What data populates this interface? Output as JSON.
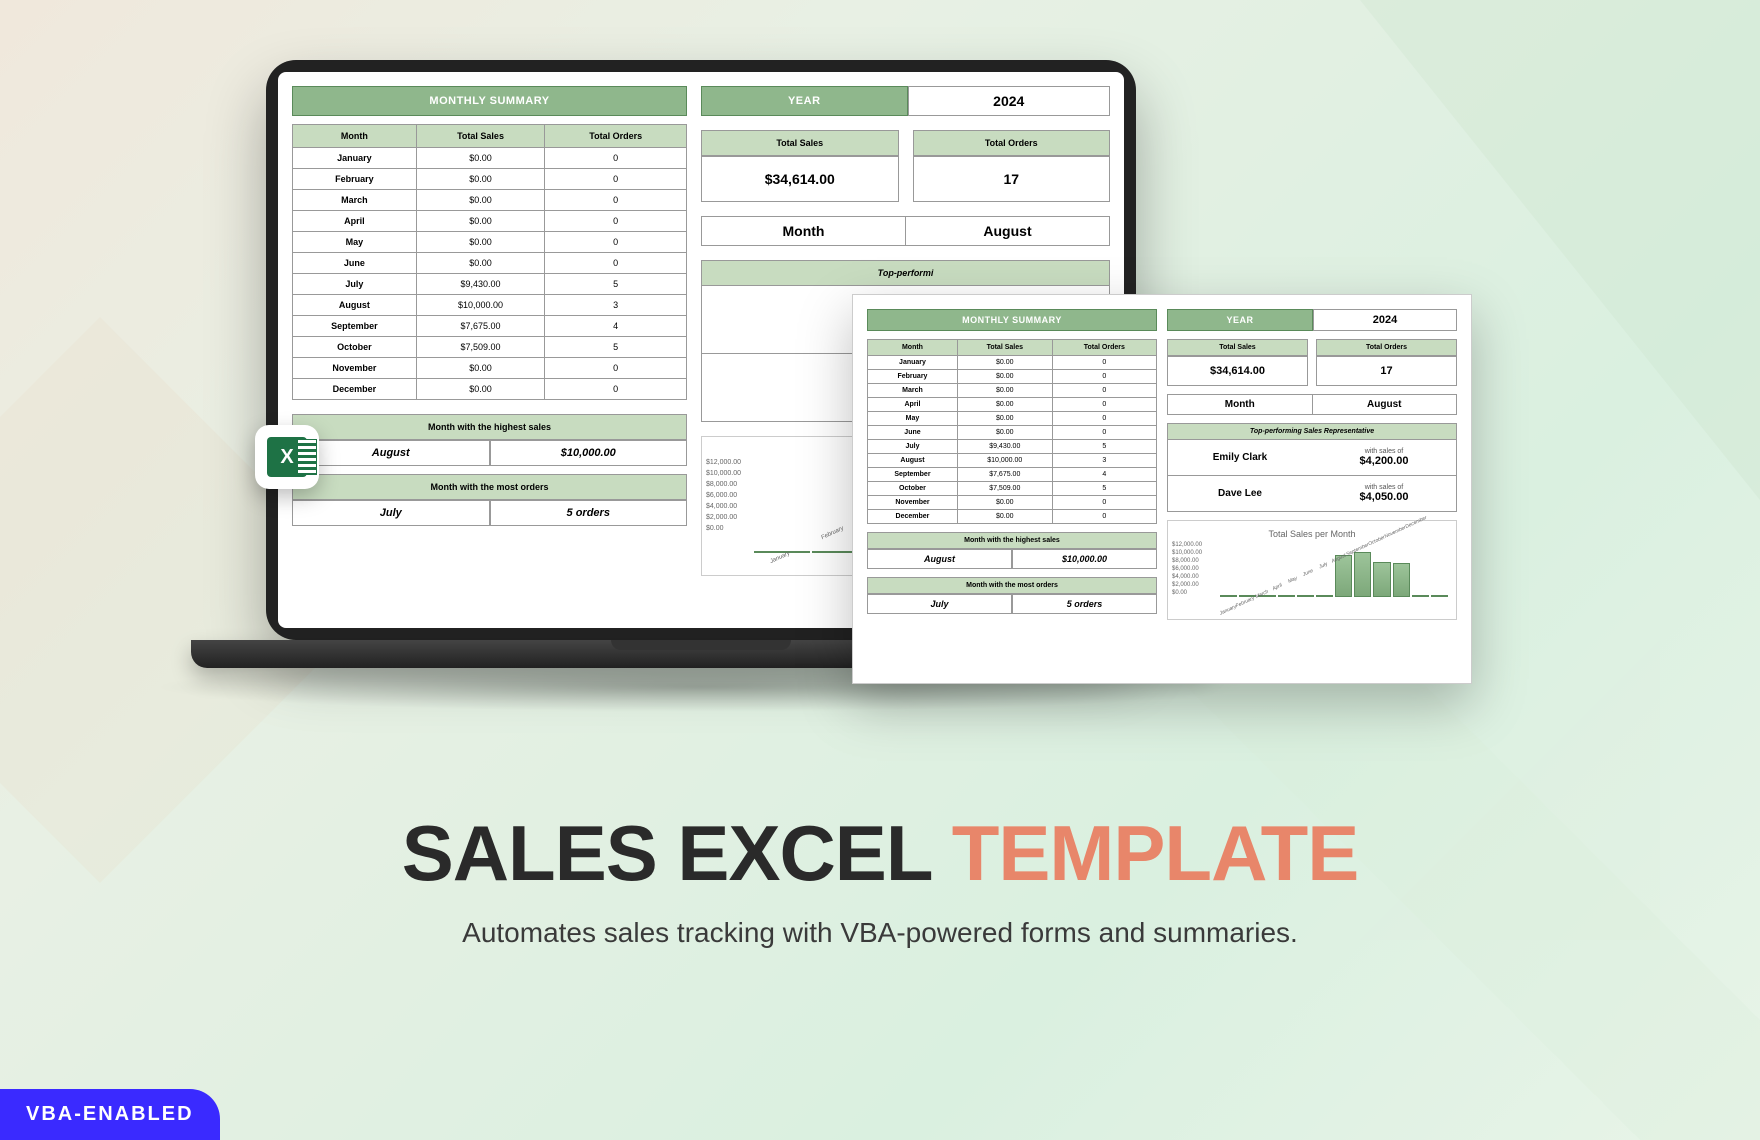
{
  "title": {
    "text1": "SALES EXCEL ",
    "text2": "TEMPLATE"
  },
  "subtitle": "Automates sales tracking with VBA-powered forms and summaries.",
  "badge": "VBA-ENABLED",
  "excel_icon_letter": "X",
  "summary": {
    "header": "MONTHLY SUMMARY",
    "cols": [
      "Month",
      "Total Sales",
      "Total Orders"
    ],
    "rows": [
      {
        "m": "January",
        "s": "$0.00",
        "o": "0"
      },
      {
        "m": "February",
        "s": "$0.00",
        "o": "0"
      },
      {
        "m": "March",
        "s": "$0.00",
        "o": "0"
      },
      {
        "m": "April",
        "s": "$0.00",
        "o": "0"
      },
      {
        "m": "May",
        "s": "$0.00",
        "o": "0"
      },
      {
        "m": "June",
        "s": "$0.00",
        "o": "0"
      },
      {
        "m": "July",
        "s": "$9,430.00",
        "o": "5"
      },
      {
        "m": "August",
        "s": "$10,000.00",
        "o": "3"
      },
      {
        "m": "September",
        "s": "$7,675.00",
        "o": "4"
      },
      {
        "m": "October",
        "s": "$7,509.00",
        "o": "5"
      },
      {
        "m": "November",
        "s": "$0.00",
        "o": "0"
      },
      {
        "m": "December",
        "s": "$0.00",
        "o": "0"
      }
    ]
  },
  "year": {
    "label": "YEAR",
    "value": "2024"
  },
  "totals": {
    "sales_label": "Total Sales",
    "sales_value": "$34,614.00",
    "orders_label": "Total Orders",
    "orders_value": "17"
  },
  "month_selector": {
    "label": "Month",
    "value": "August"
  },
  "top_rep": {
    "header": "Top-performing Sales Representative",
    "reps": [
      {
        "name": "Emily Clark",
        "sub": "with sales of",
        "val": "$4,200.00"
      },
      {
        "name": "Dave Lee",
        "sub": "with sales of",
        "val": "$4,050.00"
      }
    ]
  },
  "highest": {
    "label": "Month with the highest sales",
    "month": "August",
    "value": "$10,000.00"
  },
  "most_orders": {
    "label": "Month with the most orders",
    "month": "July",
    "value": "5 orders"
  },
  "chart_data": {
    "type": "bar",
    "title": "Total Sales per Month",
    "categories": [
      "January",
      "February",
      "March",
      "April",
      "May",
      "June",
      "July",
      "August",
      "September",
      "October",
      "November",
      "December"
    ],
    "values": [
      0,
      0,
      0,
      0,
      0,
      0,
      9430,
      10000,
      7675,
      7509,
      0,
      0
    ],
    "ylabel": "",
    "xlabel": "",
    "ylim": [
      0,
      12000
    ],
    "y_ticks": [
      "$12,000.00",
      "$10,000.00",
      "$8,000.00",
      "$6,000.00",
      "$4,000.00",
      "$2,000.00",
      "$0.00"
    ]
  }
}
